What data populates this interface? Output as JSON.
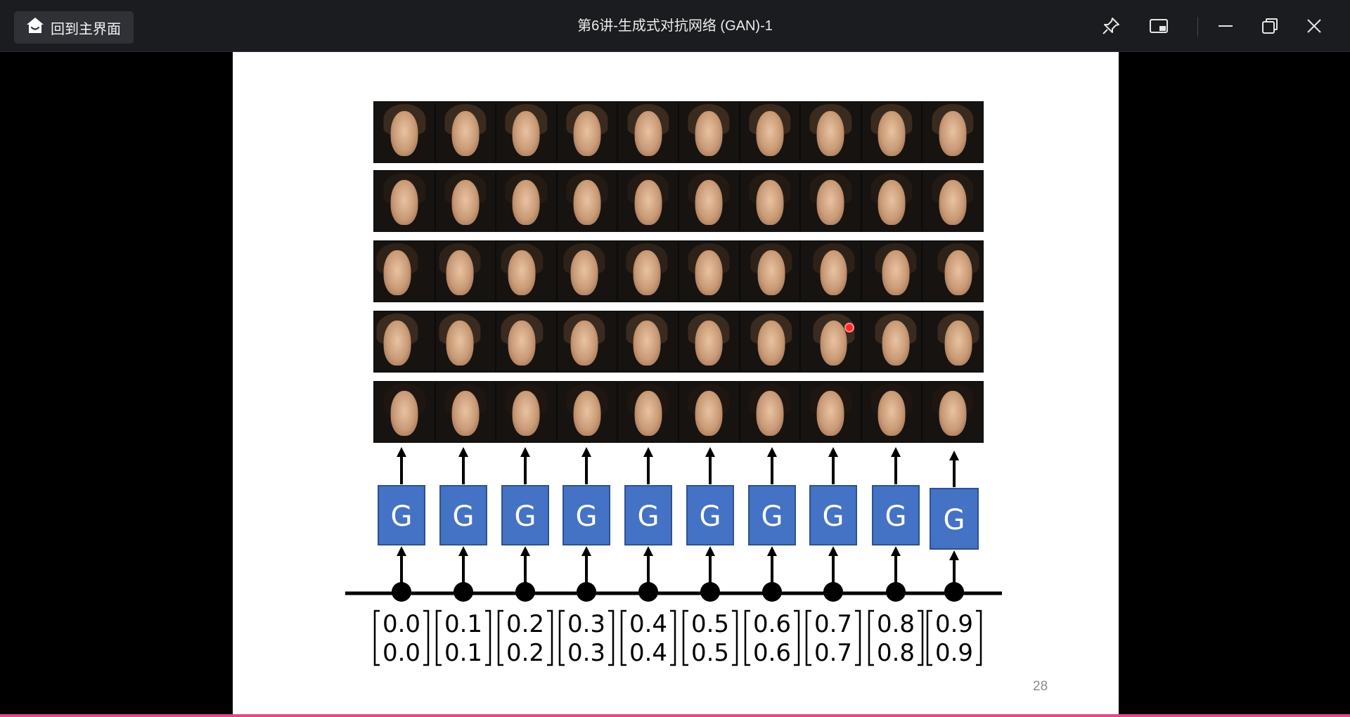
{
  "app": {
    "home_button_label": "回到主界面",
    "window_title": "第6讲-生成式对抗网络 (GAN)-1",
    "icons": [
      "home-icon",
      "pin-icon",
      "panel-toggle-icon",
      "minimize-icon",
      "restore-icon",
      "close-icon"
    ]
  },
  "slide": {
    "page_number": "28",
    "generator_label": "G",
    "face_rows": 5,
    "faces_per_row": 10,
    "vectors": [
      {
        "top": "0.0",
        "bottom": "0.0"
      },
      {
        "top": "0.1",
        "bottom": "0.1"
      },
      {
        "top": "0.2",
        "bottom": "0.2"
      },
      {
        "top": "0.3",
        "bottom": "0.3"
      },
      {
        "top": "0.4",
        "bottom": "0.4"
      },
      {
        "top": "0.5",
        "bottom": "0.5"
      },
      {
        "top": "0.6",
        "bottom": "0.6"
      },
      {
        "top": "0.7",
        "bottom": "0.7"
      },
      {
        "top": "0.8",
        "bottom": "0.8"
      },
      {
        "top": "0.9",
        "bottom": "0.9"
      }
    ],
    "colors": {
      "generator_box": "#4472c4",
      "slide_background": "#ffffff",
      "titlebar": "#1b1c1f",
      "pointer_marker": "#ff2a2a"
    }
  }
}
